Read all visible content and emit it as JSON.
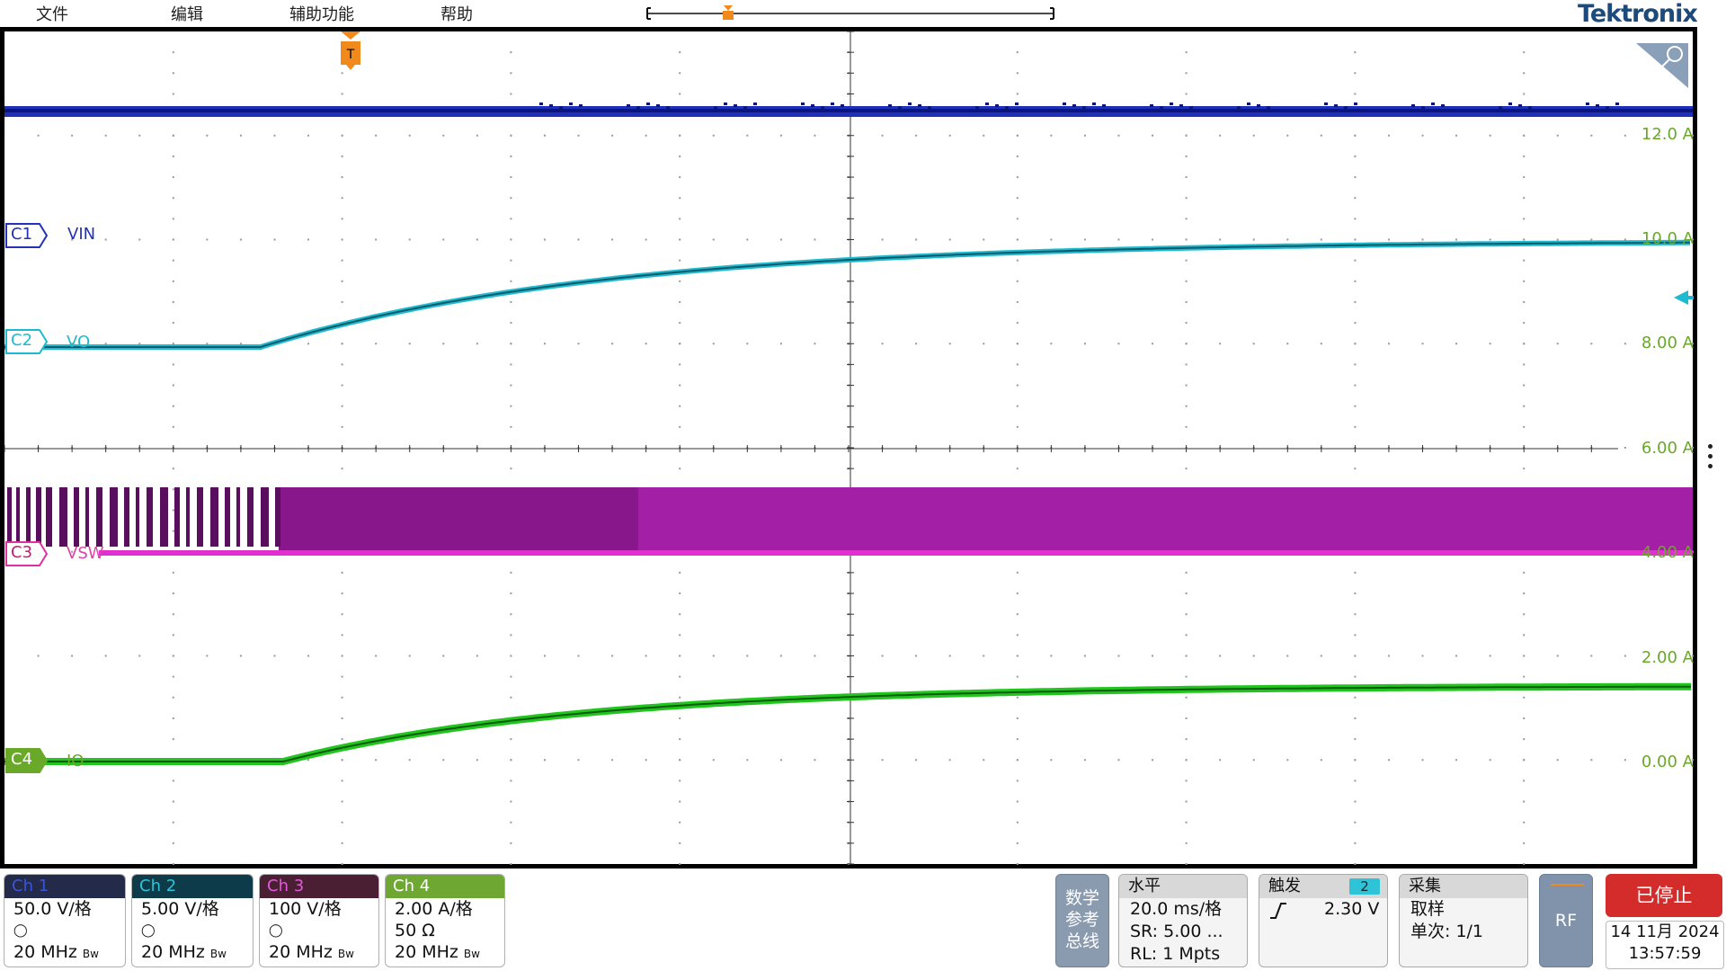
{
  "menu": [
    "文件",
    "编辑",
    "辅助功能",
    "帮助"
  ],
  "brand": "Tektronix",
  "trigger_marker": "T",
  "channels": [
    {
      "tag": "C1",
      "name": "VIN",
      "color": "#2233b8"
    },
    {
      "tag": "C2",
      "name": "VO",
      "color": "#1fbad0"
    },
    {
      "tag": "C3",
      "name": "VSW",
      "color": "#e030d0"
    },
    {
      "tag": "C4",
      "name": "IO",
      "color": "#6aa82a"
    }
  ],
  "scale_labels": [
    "12.0 A",
    "10.0 A",
    "8.00 A",
    "6.00 A",
    "4.00 A",
    "2.00 A",
    "0.00 A"
  ],
  "badges": [
    {
      "head": "Ch 1",
      "l1": "50.0 V/格",
      "l2": "",
      "l3": "20 MHz",
      "bw": "Bw",
      "head_bg": "#232a4a",
      "head_fg": "#3a56d6"
    },
    {
      "head": "Ch 2",
      "l1": "5.00 V/格",
      "l2": "",
      "l3": "20 MHz",
      "bw": "Bw",
      "head_bg": "#0d3b4a",
      "head_fg": "#2fc3d8"
    },
    {
      "head": "Ch 3",
      "l1": "100 V/格",
      "l2": "",
      "l3": "20 MHz",
      "bw": "Bw",
      "head_bg": "#4a1f34",
      "head_fg": "#e05ad8"
    },
    {
      "head": "Ch 4",
      "l1": "2.00 A/格",
      "l2": "50 Ω",
      "l3": "20 MHz",
      "bw": "Bw",
      "head_bg": "#6ea832",
      "head_fg": "#ffffff"
    }
  ],
  "math_ref_bus": [
    "数学",
    "参考",
    "总线"
  ],
  "horizontal": {
    "head": "水平",
    "l1": "20.0 ms/格",
    "l2": "SR: 5.00 ...",
    "l3": "RL: 1 Mpts"
  },
  "trigger": {
    "head": "触发",
    "source": "2",
    "level": "2.30 V"
  },
  "acquire": {
    "head": "采集",
    "l1": "取样",
    "l2": "单次: 1/1"
  },
  "rf": "RF",
  "status": "已停止",
  "date": "14 11月 2024",
  "time": "13:57:59"
}
